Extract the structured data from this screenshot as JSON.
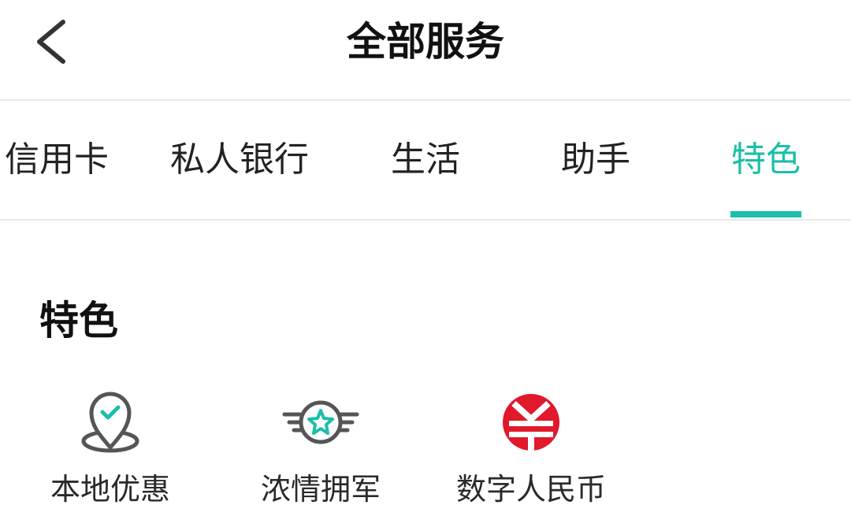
{
  "header": {
    "title": "全部服务",
    "back_icon": "chevron-left-icon"
  },
  "tabs": [
    {
      "label": "信用卡",
      "active": false
    },
    {
      "label": "私人银行",
      "active": false
    },
    {
      "label": "生活",
      "active": false
    },
    {
      "label": "助手",
      "active": false
    },
    {
      "label": "特色",
      "active": true
    }
  ],
  "section": {
    "title": "特色",
    "items": [
      {
        "label": "本地优惠",
        "icon": "location-check-icon"
      },
      {
        "label": "浓情拥军",
        "icon": "star-wings-badge-icon"
      },
      {
        "label": "数字人民币",
        "icon": "digital-rmb-icon"
      }
    ]
  },
  "colors": {
    "accent": "#1bbfa8",
    "icon_gray": "#555555",
    "rmb_red": "#e0192c",
    "divider": "#ececec"
  }
}
